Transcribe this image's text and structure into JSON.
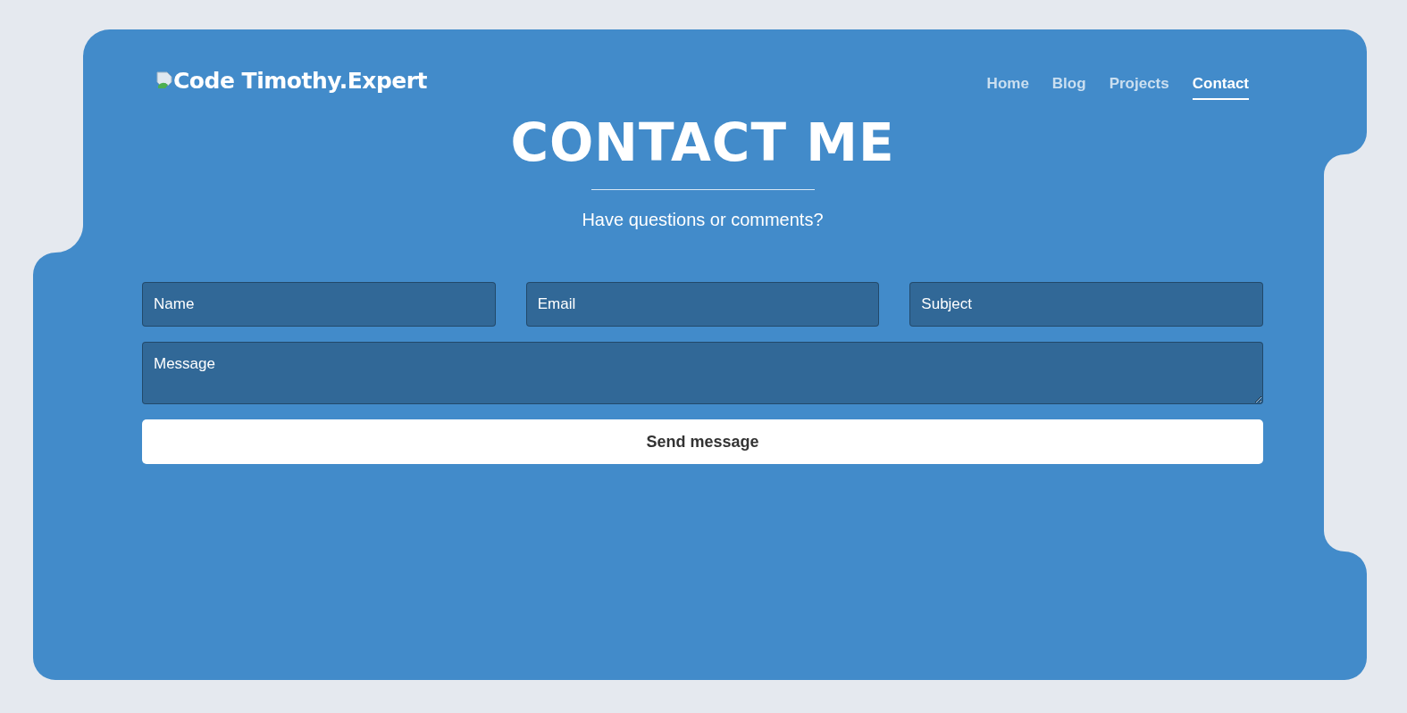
{
  "logo": {
    "text": "Code Timothy.Expert"
  },
  "nav": [
    {
      "label": "Home",
      "selected": false
    },
    {
      "label": "Blog",
      "selected": false
    },
    {
      "label": "Projects",
      "selected": false
    },
    {
      "label": "Contact",
      "selected": true
    }
  ],
  "heading": "CONTACT ME",
  "subtitle": "Have questions or comments?",
  "form": {
    "fields": [
      {
        "placeholder": "Name"
      },
      {
        "placeholder": "Email"
      },
      {
        "placeholder": "Subject"
      }
    ],
    "message": {
      "placeholder": "Message"
    },
    "submit": "Send message"
  }
}
